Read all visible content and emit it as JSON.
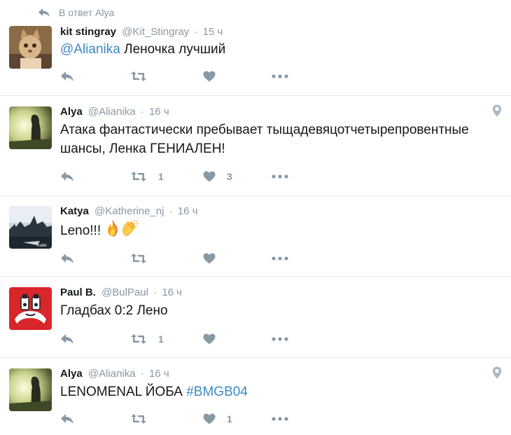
{
  "reply_context": {
    "label": "В ответ Alya"
  },
  "tweets": [
    {
      "name": "kit stingray",
      "handle": "@Kit_Stingray",
      "time": "15 ч",
      "text_mention": "@Alianika",
      "text_main": " Леночка лучший",
      "retweets": "",
      "likes": "",
      "has_location": false
    },
    {
      "name": "Alya",
      "handle": "@Alianika",
      "time": "16 ч",
      "text_line1": "Атака фантастически пребывает тыщадевяцотчетырепровентные",
      "text_line2": "шансы, Ленка ГЕНИАЛЕН!",
      "retweets": "1",
      "likes": "3",
      "has_location": true
    },
    {
      "name": "Katya",
      "handle": "@Katherine_nj",
      "time": "16 ч",
      "text_main": "Leno!!!",
      "retweets": "",
      "likes": "",
      "has_location": false
    },
    {
      "name": "Paul B.",
      "handle": "@BulPaul",
      "time": "16 ч",
      "text_main": "Гладбах 0:2 Лено",
      "retweets": "1",
      "likes": "",
      "has_location": false
    },
    {
      "name": "Alya",
      "handle": "@Alianika",
      "time": "16 ч",
      "text_main": "LENOMENAL ЙОБА ",
      "text_hashtag": "#BMGB04",
      "retweets": "",
      "likes": "1",
      "has_location": true
    }
  ],
  "icons": {
    "reply": "reply-icon",
    "retweet": "retweet-icon",
    "like": "heart-icon",
    "more": "more-dots-icon",
    "location": "location-pin-icon",
    "fire": "fire-emoji",
    "clap": "clapping-hands-emoji"
  },
  "colors": {
    "icon_gray": "#8899a6",
    "link": "#3b8ac4",
    "separator": "#e6ecf0",
    "text": "#14171a"
  }
}
